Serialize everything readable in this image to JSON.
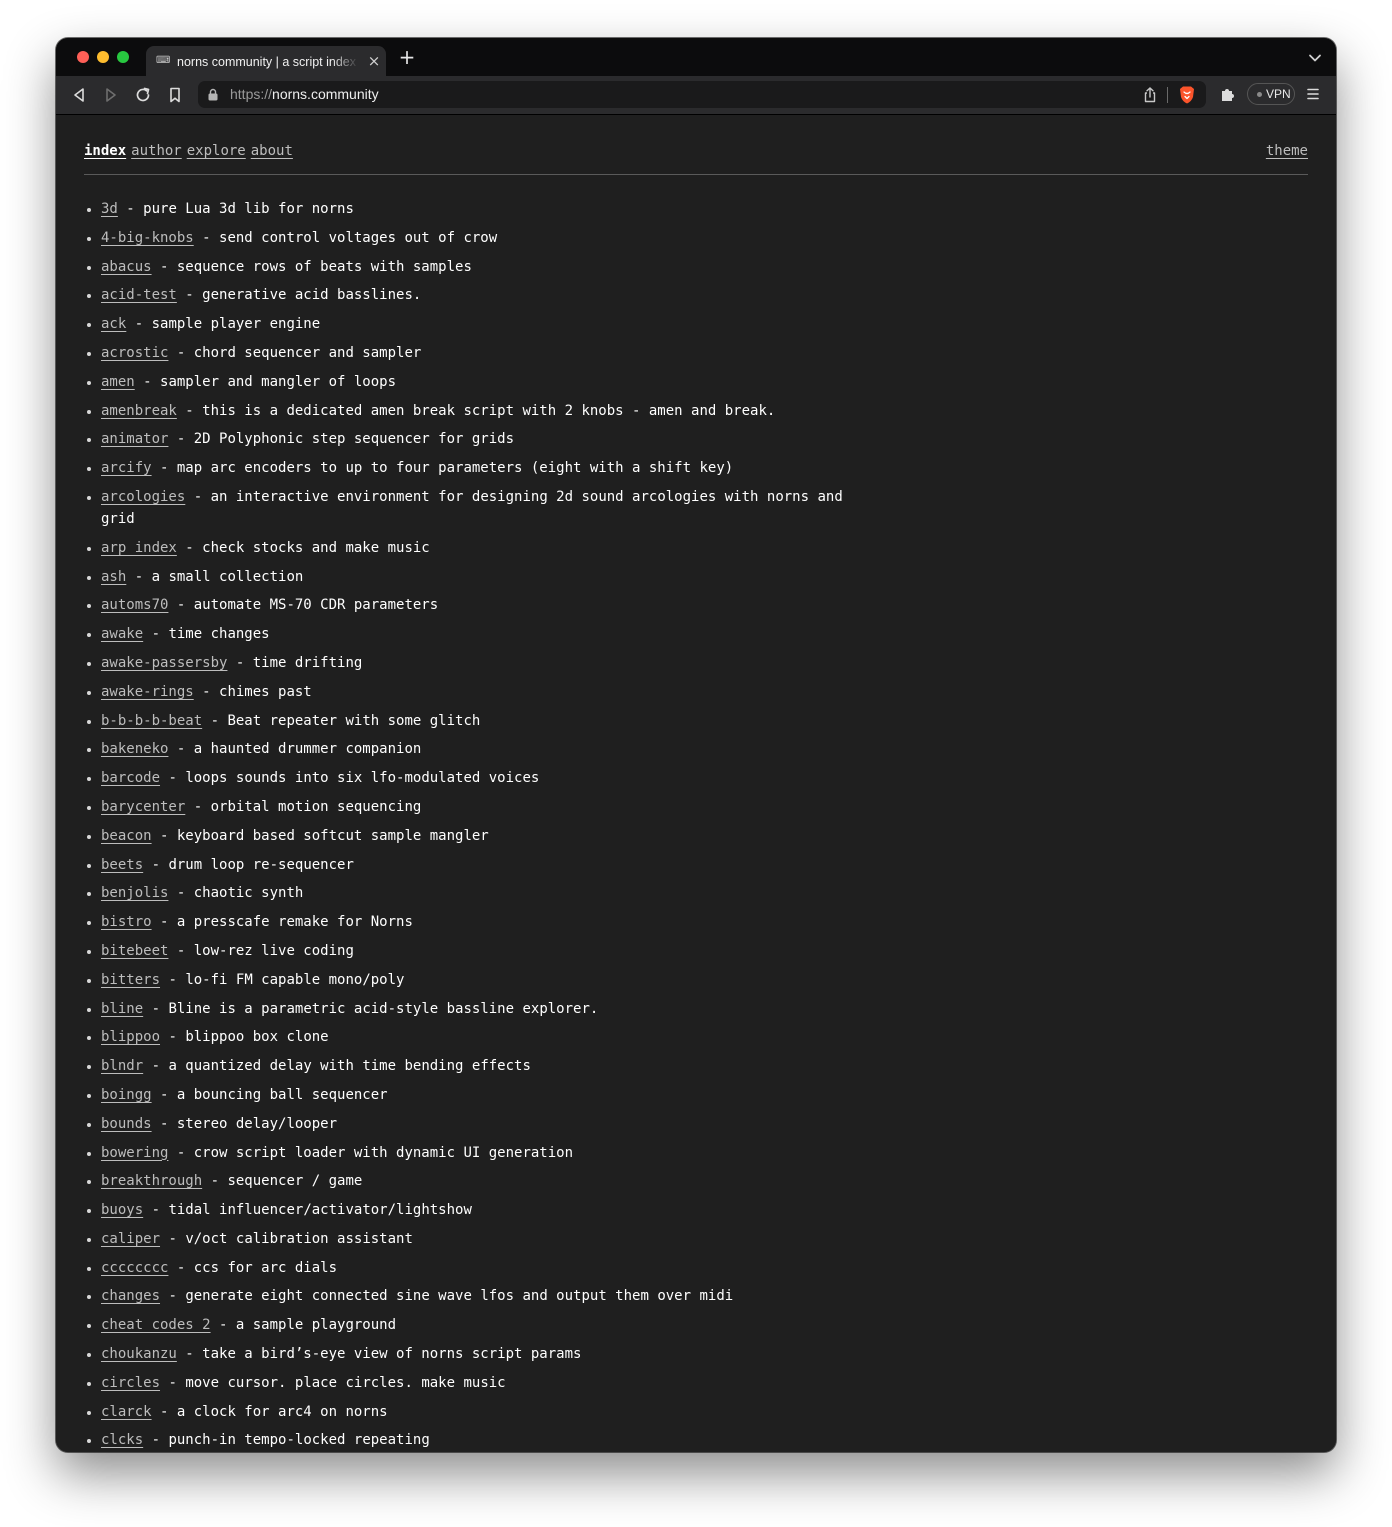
{
  "browser": {
    "tab_favicon": "⌨",
    "tab_title": "norns community | a script index",
    "url_scheme": "https://",
    "url_host": "norns.community",
    "vpn_label": "VPN"
  },
  "colors": {
    "background": "#1f1f1f",
    "text": "#ffffff",
    "link": "#bdbdbd",
    "brave_orange": "#fb542b"
  },
  "nav": {
    "items": [
      {
        "label": "index",
        "active": true
      },
      {
        "label": "author",
        "active": false
      },
      {
        "label": "explore",
        "active": false
      },
      {
        "label": "about",
        "active": false
      }
    ],
    "theme_label": "theme"
  },
  "scripts": [
    {
      "name": "3d",
      "description": "pure Lua 3d lib for norns"
    },
    {
      "name": "4-big-knobs",
      "description": "send control voltages out of crow"
    },
    {
      "name": "abacus",
      "description": "sequence rows of beats with samples"
    },
    {
      "name": "acid-test",
      "description": "generative acid basslines."
    },
    {
      "name": "ack",
      "description": "sample player engine"
    },
    {
      "name": "acrostic",
      "description": "chord sequencer and sampler"
    },
    {
      "name": "amen",
      "description": "sampler and mangler of loops"
    },
    {
      "name": "amenbreak",
      "description": "this is a dedicated amen break script with 2 knobs - amen and break."
    },
    {
      "name": "animator",
      "description": "2D Polyphonic step sequencer for grids"
    },
    {
      "name": "arcify",
      "description": "map arc encoders to up to four parameters (eight with a shift key)"
    },
    {
      "name": "arcologies",
      "description": "an interactive environment for designing 2d sound arcologies with norns and grid"
    },
    {
      "name": "arp_index",
      "description": "check stocks and make music"
    },
    {
      "name": "ash",
      "description": "a small collection"
    },
    {
      "name": "automs70",
      "description": "automate MS-70 CDR parameters"
    },
    {
      "name": "awake",
      "description": "time changes"
    },
    {
      "name": "awake-passersby",
      "description": "time drifting"
    },
    {
      "name": "awake-rings",
      "description": "chimes past"
    },
    {
      "name": "b-b-b-b-beat",
      "description": "Beat repeater with some glitch"
    },
    {
      "name": "bakeneko",
      "description": "a haunted drummer companion"
    },
    {
      "name": "barcode",
      "description": "loops sounds into six lfo-modulated voices"
    },
    {
      "name": "barycenter",
      "description": "orbital motion sequencing"
    },
    {
      "name": "beacon",
      "description": "keyboard based softcut sample mangler"
    },
    {
      "name": "beets",
      "description": "drum loop re-sequencer"
    },
    {
      "name": "benjolis",
      "description": "chaotic synth"
    },
    {
      "name": "bistro",
      "description": "a presscafe remake for Norns"
    },
    {
      "name": "bitebeet",
      "description": "low-rez live coding"
    },
    {
      "name": "bitters",
      "description": "lo-fi FM capable mono/poly"
    },
    {
      "name": "bline",
      "description": "Bline is a parametric acid-style bassline explorer."
    },
    {
      "name": "blippoo",
      "description": "blippoo box clone"
    },
    {
      "name": "blndr",
      "description": "a quantized delay with time bending effects"
    },
    {
      "name": "boingg",
      "description": "a bouncing ball sequencer"
    },
    {
      "name": "bounds",
      "description": "stereo delay/looper"
    },
    {
      "name": "bowering",
      "description": "crow script loader with dynamic UI generation"
    },
    {
      "name": "breakthrough",
      "description": "sequencer / game"
    },
    {
      "name": "buoys",
      "description": "tidal influencer/activator/lightshow"
    },
    {
      "name": "caliper",
      "description": "v/oct calibration assistant"
    },
    {
      "name": "cccccccc",
      "description": "ccs for arc dials"
    },
    {
      "name": "changes",
      "description": "generate eight connected sine wave lfos and output them over midi"
    },
    {
      "name": "cheat_codes_2",
      "description": "a sample playground"
    },
    {
      "name": "choukanzu",
      "description": "take a bird’s-eye view of norns script params"
    },
    {
      "name": "circles",
      "description": "move cursor. place circles. make music"
    },
    {
      "name": "clarck",
      "description": "a clock for arc4 on norns"
    },
    {
      "name": "clcks",
      "description": "punch-in tempo-locked repeating"
    }
  ]
}
